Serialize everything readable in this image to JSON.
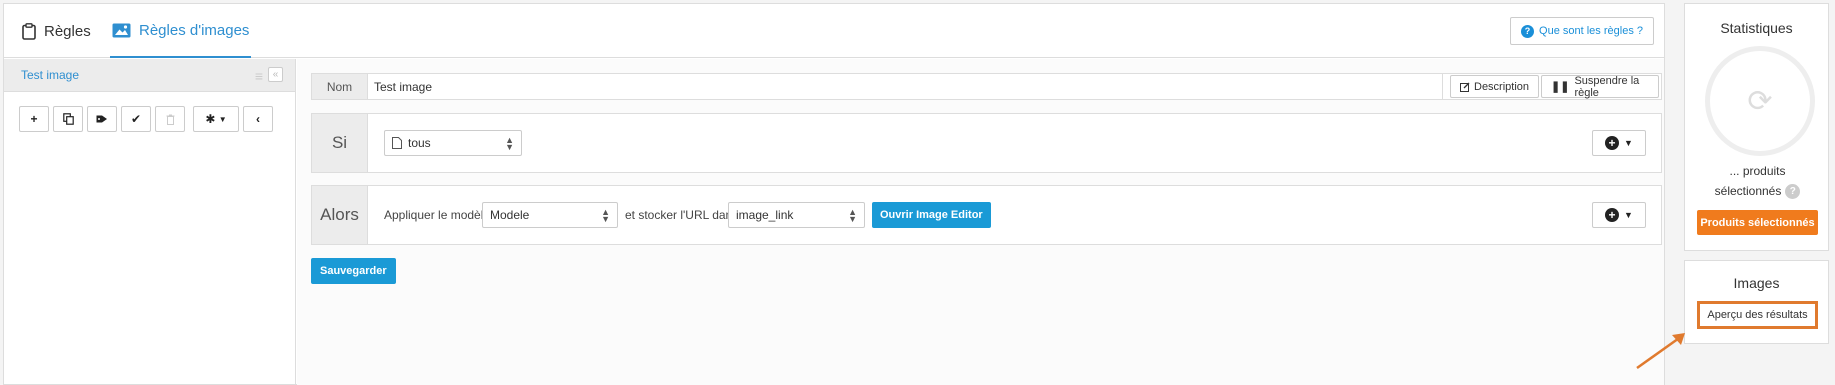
{
  "tabs": {
    "rules": "Règles",
    "image_rules": "Règles d'images",
    "help": "Que sont les règles ?"
  },
  "left_pane": {
    "title": "Test image"
  },
  "rule": {
    "name_label": "Nom",
    "name_value": "Test image",
    "description_btn": "Description",
    "suspend_btn": "Suspendre la règle",
    "if_label": "Si",
    "if_select": "tous",
    "then_label": "Alors",
    "apply_text": "Appliquer le modèle",
    "model_select": "Modele",
    "store_text": "et stocker l'URL dans",
    "field_select": "image_link",
    "open_editor_btn": "Ouvrir Image Editor",
    "save_btn": "Sauvegarder"
  },
  "stats": {
    "title": "Statistiques",
    "count_line1": "... produits",
    "count_line2": "sélectionnés",
    "selected_btn": "Produits sélectionnés"
  },
  "images": {
    "title": "Images",
    "preview_btn": "Aperçu des résultats"
  },
  "colors": {
    "accent": "#1a9ad6",
    "orange": "#f07b1d",
    "highlight": "#e07a2e"
  }
}
